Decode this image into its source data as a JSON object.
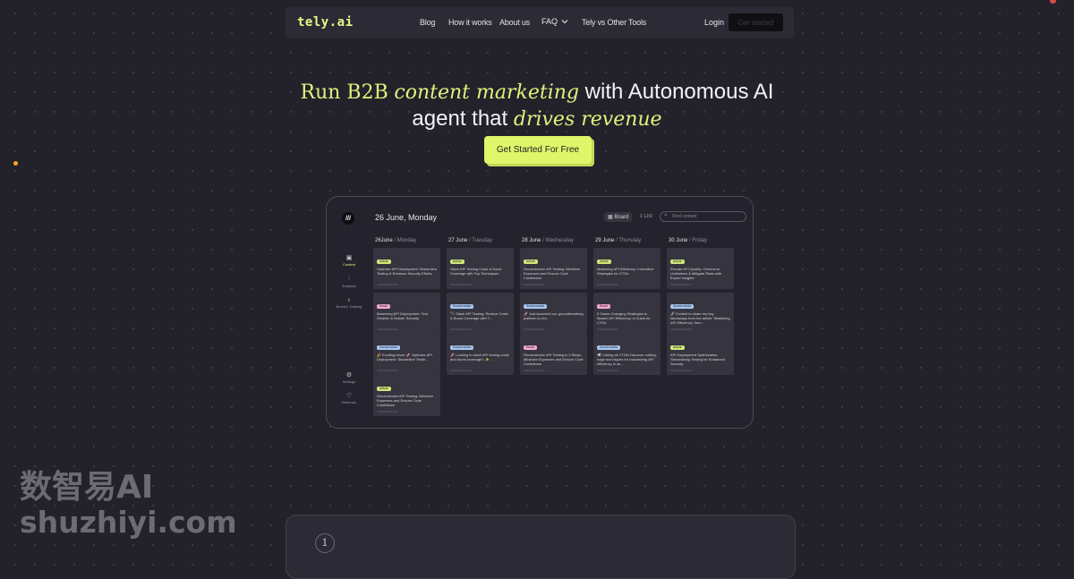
{
  "nav": {
    "logo": "tely.ai",
    "links": [
      "Blog",
      "How it works",
      "About us",
      "FAQ",
      "Tely vs Other Tools"
    ],
    "login": "Login",
    "cta": "Get started"
  },
  "hero": {
    "line1_a": "Run B2B",
    "line1_b": "content marketing",
    "line1_c": "with Autonomous AI",
    "line2_a": "agent that",
    "line2_b": "drives revenue",
    "cta": "Get Started For Free"
  },
  "app": {
    "date": "26 June, Monday",
    "board": "Board",
    "list": "List",
    "search_placeholder": "Find content",
    "sidebar": [
      {
        "label": "Content",
        "icon": "calendar-icon"
      },
      {
        "label": "Analytics",
        "icon": "chart-icon"
      },
      {
        "label": "Brand's Training",
        "icon": "lightbulb-icon"
      },
      {
        "label": "Settings",
        "icon": "gear-icon"
      },
      {
        "label": "Referrals",
        "icon": "heart-icon"
      }
    ],
    "days": [
      {
        "date": "26June",
        "weekday": "/ Monday"
      },
      {
        "date": "27 June",
        "weekday": "/ Tuesday"
      },
      {
        "date": "28 June",
        "weekday": "/ Wednesday"
      },
      {
        "date": "29 June",
        "weekday": "/ Thursday"
      },
      {
        "date": "30 June",
        "weekday": "/ Friday"
      }
    ],
    "columns": [
      [
        {
          "badge": "Article",
          "type": "article",
          "text": "Optimize API Deployment: Streamline Testing & Enhance Security Efforts"
        },
        {
          "badge": "Email",
          "type": "email",
          "text": "Mastering API Deployment: Test Smarter & Bolster Security"
        },
        {
          "badge": "Social media",
          "type": "social",
          "text": "🎉 Exciting news! 🚀 Optimize API Deployment: Streamline Testin..."
        },
        {
          "badge": "Article",
          "type": "article",
          "text": "Revolutionize API Testing: Minimize Expenses and Ensure Code Confidence"
        }
      ],
      [
        {
          "badge": "Article",
          "type": "article",
          "text": "Slash API Testing Costs & Boost Coverage with Top Techniques"
        },
        {
          "badge": "Social media",
          "type": "social",
          "text": "🏷 Slash API Testing: Reduce Costs & Boost Coverage with T..."
        },
        {
          "badge": "Social media",
          "type": "social",
          "text": "🚀 Looking to slash API testing costs and boost coverage? ✨..."
        }
      ],
      [
        {
          "badge": "Article",
          "type": "article",
          "text": "Revolutionize API Testing: Minimize Expenses and Ensure Code Confidence"
        },
        {
          "badge": "Social media",
          "type": "social",
          "text": "🚀 Just launched our groundbreaking platform to rev..."
        },
        {
          "badge": "Email",
          "type": "email",
          "text": "Revolutionize API Testing in 3 Steps: Minimize Expenses and Ensure Code Confidence"
        }
      ],
      [
        {
          "badge": "Article",
          "type": "article",
          "text": "Mastering API Efficiency: Innovative Strategies for CTOs"
        },
        {
          "badge": "Email",
          "type": "email",
          "text": "5 Game-Changing Strategies to Master API Efficiency: A Guide for CTOs"
        },
        {
          "badge": "Social media",
          "type": "social",
          "text": "📢 Calling all CTOs! Discover cutting-edge techniques for maximizing API efficiency in ou..."
        }
      ],
      [
        {
          "badge": "Article",
          "type": "article",
          "text": "Elevate API Quality: Overcome Limitations & Mitigate Risks with Expert Insights"
        },
        {
          "badge": "Social media",
          "type": "social",
          "text": "🚀 Excited to share my key takeaways from the article \"Mastering API Efficiency: Inno..."
        },
        {
          "badge": "Article",
          "type": "article",
          "text": "API Deployment Optimization: Streamlining Testing for Enhanced Security"
        }
      ]
    ]
  },
  "section": {
    "number": "1"
  },
  "watermark": {
    "line1": "数智易AI",
    "line2": "shuzhiyi.com"
  },
  "colors": {
    "background": "#23222b",
    "accent": "#e0f56a",
    "panel": "#2c2b35"
  }
}
